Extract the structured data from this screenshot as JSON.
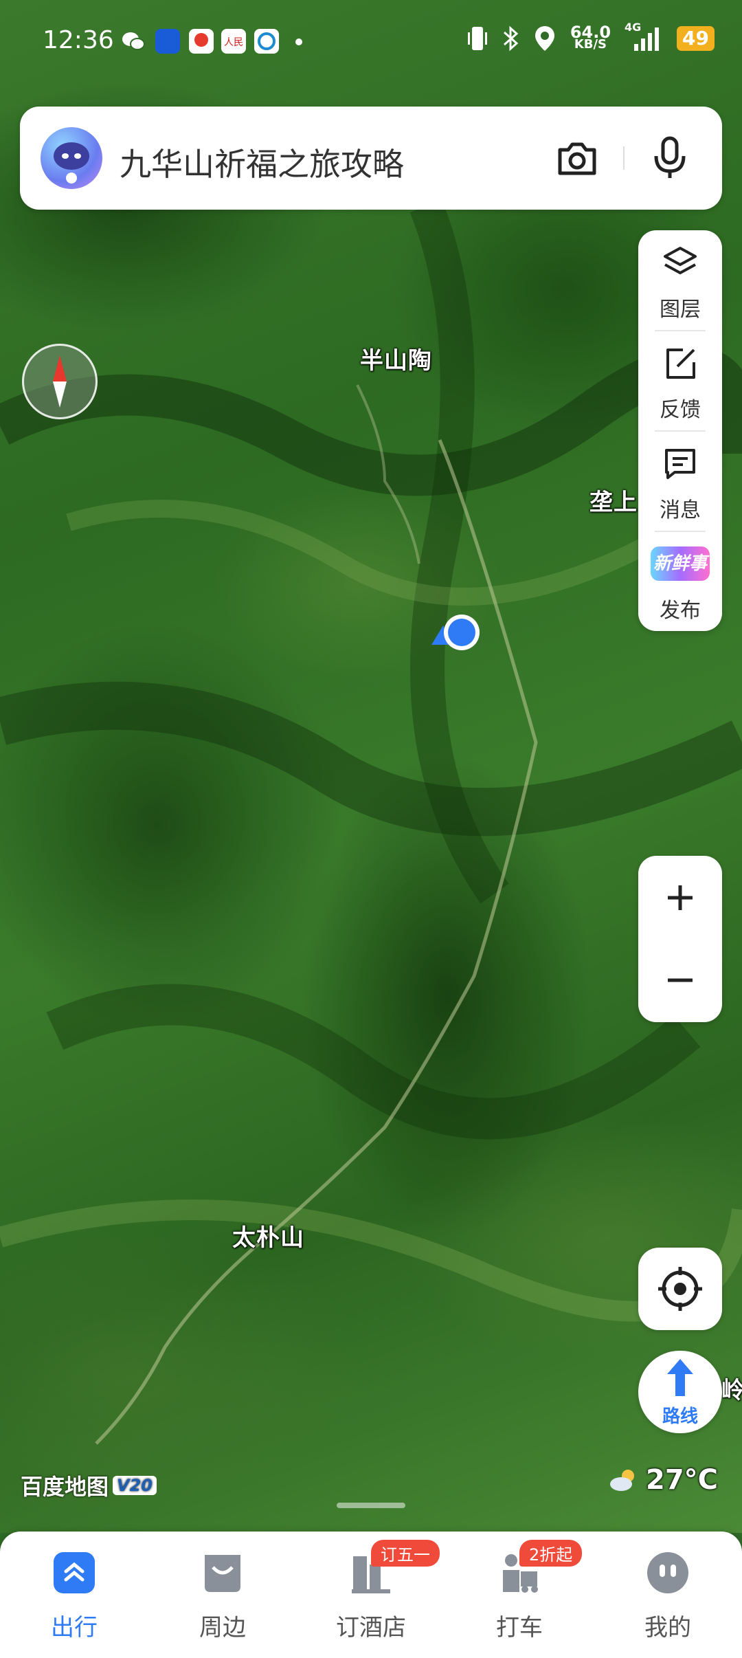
{
  "status_bar": {
    "time": "12:36",
    "net_speed_value": "64.0",
    "net_speed_unit": "KB/S",
    "network_type": "4G",
    "battery": "49",
    "battery_color": "#f2b01e"
  },
  "search": {
    "placeholder": "九华山祈福之旅攻略"
  },
  "map": {
    "labels": {
      "banshantao": "半山陶",
      "kengshang": "垄上",
      "taipushan": "太朴山",
      "edge_right": "岭"
    }
  },
  "tools": [
    {
      "label": "图层",
      "icon": "layers-icon"
    },
    {
      "label": "反馈",
      "icon": "feedback-icon"
    },
    {
      "label": "消息",
      "icon": "message-icon"
    },
    {
      "label": "发布",
      "icon": "news-icon",
      "badge_text": "新鲜事"
    }
  ],
  "zoom": {
    "in": "+",
    "out": "−"
  },
  "route": {
    "label": "路线"
  },
  "logo": {
    "text": "百度地图",
    "version": "V20"
  },
  "weather": {
    "temperature": "27°C",
    "icon": "partly-cloudy-icon"
  },
  "bottom_nav": [
    {
      "label": "出行",
      "icon": "travel-icon",
      "active": true
    },
    {
      "label": "周边",
      "icon": "nearby-icon",
      "active": false
    },
    {
      "label": "订酒店",
      "icon": "hotel-icon",
      "active": false,
      "badge": "订五一"
    },
    {
      "label": "打车",
      "icon": "taxi-icon",
      "active": false,
      "badge": "2折起"
    },
    {
      "label": "我的",
      "icon": "profile-icon",
      "active": false
    }
  ],
  "colors": {
    "accent": "#2f7bf5",
    "badge": "#f04a3a",
    "location_dot": "#2f7bf5"
  }
}
